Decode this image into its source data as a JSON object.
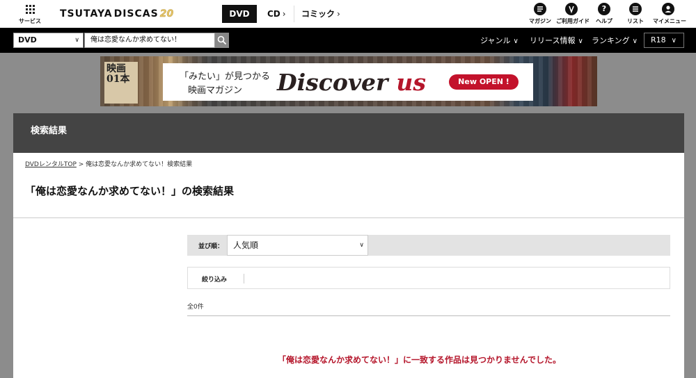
{
  "header": {
    "services_label": "サービス",
    "logo_text_1": "TSUTAYA",
    "logo_text_2": "DISCAS",
    "logo_text_3": "20",
    "categories": [
      {
        "label": "DVD",
        "active": true
      },
      {
        "label": "CD",
        "active": false
      },
      {
        "label": "コミック",
        "active": false
      }
    ],
    "chevron": "›",
    "icons": [
      {
        "label": "マガジン",
        "icon": "magazine-icon"
      },
      {
        "label": "ご利用ガイド",
        "icon": "guide-icon"
      },
      {
        "label": "ヘルプ",
        "icon": "help-icon",
        "glyph": "?"
      },
      {
        "label": "リスト",
        "icon": "list-icon"
      },
      {
        "label": "マイメニュー",
        "icon": "user-icon"
      }
    ]
  },
  "searchbar": {
    "category_value": "DVD",
    "query": "俺は恋愛なんか求めてない！",
    "nav": [
      {
        "label": "ジャンル"
      },
      {
        "label": "リリース情報"
      },
      {
        "label": "ランキング"
      }
    ],
    "r18_label": "R18"
  },
  "banner": {
    "line1": "「みたい」が見つかる",
    "line2": "映画マガジン",
    "discover": "Discover",
    "us": "us",
    "open": "New OPEN !",
    "poster_text": "映画\n01本"
  },
  "panel": {
    "header_title": "検索結果",
    "breadcrumb_link": "DVDレンタルTOP",
    "breadcrumb_sep": " > ",
    "breadcrumb_current": "俺は恋愛なんか求めてない！検索結果",
    "page_title": "「俺は恋愛なんか求めてない！」の検索結果",
    "sort_label": "並び順：",
    "sort_value": "人気順",
    "filter_label": "絞り込み",
    "count": "全0件",
    "not_found": "「俺は恋愛なんか求めてない！」に一致する作品は見つかりませんでした。"
  },
  "colors": {
    "accent_red": "#b5162b",
    "header_dark": "#444444",
    "topnav_black": "#000000"
  }
}
